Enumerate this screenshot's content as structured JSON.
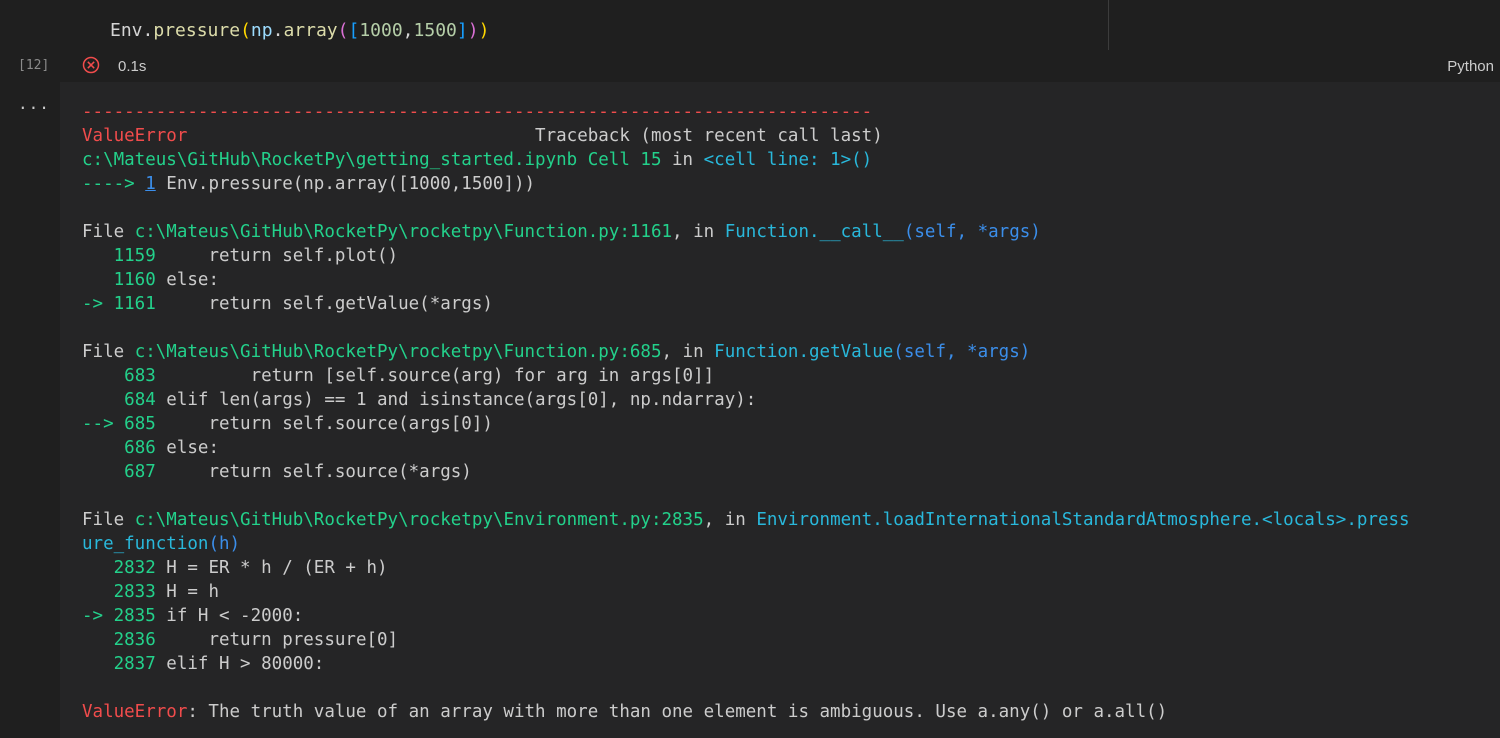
{
  "cell": {
    "code_parts": [
      "Env",
      ".",
      "pressure",
      "(",
      "np",
      ".",
      "array",
      "(",
      "[",
      "1000",
      ",",
      "1500",
      "]",
      ")",
      ")"
    ],
    "execution_count": "[12]",
    "status": "error",
    "duration": "0.1s",
    "language": "Python"
  },
  "output": {
    "menu_glyph": "...",
    "traceback": {
      "separator": "---------------------------------------------------------------------------",
      "error_name": "ValueError",
      "header": "Traceback (most recent call last)",
      "cell_path": "c:\\Mateus\\GitHub\\RocketPy\\getting_started.ipynb Cell 15",
      "in_word": " in ",
      "cell_loc": "<cell line: 1>()",
      "arrow_line": {
        "arrow": "----> ",
        "lineno": "1",
        "code": " Env.pressure(np.array([1000,1500]))"
      },
      "frames": [
        {
          "file_label": "File ",
          "path": "c:\\Mateus\\GitHub\\RocketPy\\rocketpy\\Function.py:1161",
          "sep": ", in ",
          "func": "Function.__call__",
          "args": "(self, *args)",
          "lines": [
            {
              "prefix": "   ",
              "no": "1159",
              "code": "     return self.plot()"
            },
            {
              "prefix": "   ",
              "no": "1160",
              "code": " else:"
            },
            {
              "prefix": "-> ",
              "no": "1161",
              "code": "     return self.getValue(*args)"
            }
          ]
        },
        {
          "file_label": "File ",
          "path": "c:\\Mateus\\GitHub\\RocketPy\\rocketpy\\Function.py:685",
          "sep": ", in ",
          "func": "Function.getValue",
          "args": "(self, *args)",
          "lines": [
            {
              "prefix": "    ",
              "no": "683",
              "code": "         return [self.source(arg) for arg in args[0]]"
            },
            {
              "prefix": "    ",
              "no": "684",
              "code": " elif len(args) == 1 and isinstance(args[0], np.ndarray):"
            },
            {
              "prefix": "--> ",
              "no": "685",
              "code": "     return self.source(args[0])"
            },
            {
              "prefix": "    ",
              "no": "686",
              "code": " else:"
            },
            {
              "prefix": "    ",
              "no": "687",
              "code": "     return self.source(*args)"
            }
          ]
        },
        {
          "file_label": "File ",
          "path": "c:\\Mateus\\GitHub\\RocketPy\\rocketpy\\Environment.py:2835",
          "sep": ", in ",
          "func": "Environment.loadInternationalStandardAtmosphere.<locals>.press\nure_function",
          "args": "(h)",
          "lines": [
            {
              "prefix": "   ",
              "no": "2832",
              "code": " H = ER * h / (ER + h)"
            },
            {
              "prefix": "   ",
              "no": "2833",
              "code": " H = h"
            },
            {
              "prefix": "-> ",
              "no": "2835",
              "code": " if H < -2000:"
            },
            {
              "prefix": "   ",
              "no": "2836",
              "code": "     return pressure[0]"
            },
            {
              "prefix": "   ",
              "no": "2837",
              "code": " elif H > 80000:"
            }
          ]
        }
      ],
      "final_error_name": "ValueError",
      "final_message": ": The truth value of an array with more than one element is ambiguous. Use a.any() or a.all()"
    }
  },
  "colors": {
    "error": "#f14c4c",
    "path": "#23d18b",
    "func": "#29b8db",
    "args": "#3b8eea"
  }
}
